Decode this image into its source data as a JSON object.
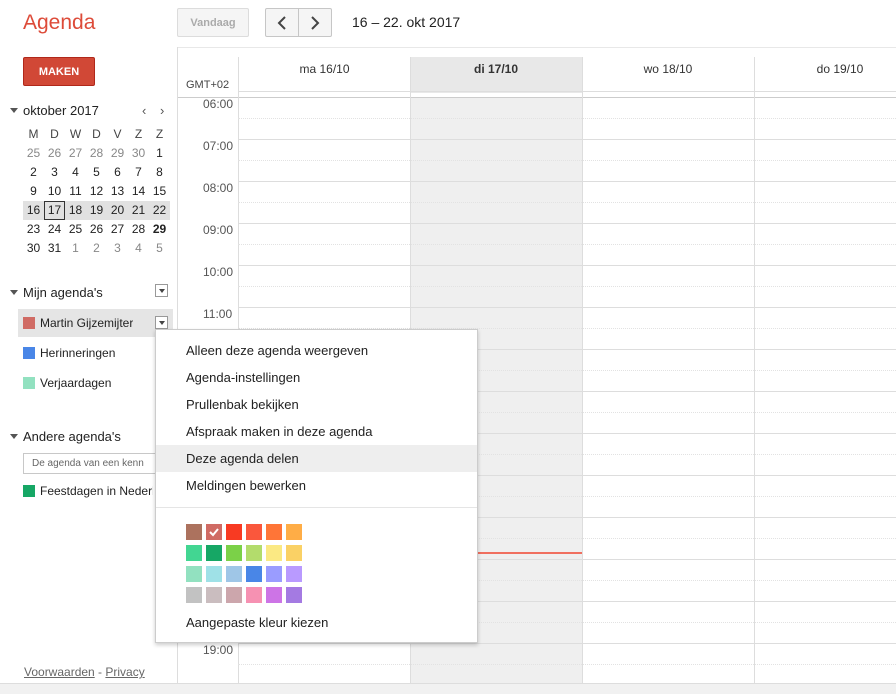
{
  "header": {
    "app_title": "Agenda",
    "today_label": "Vandaag",
    "date_range": "16 – 22. okt 2017",
    "create_label": "MAKEN"
  },
  "mini_calendar": {
    "title": "oktober 2017",
    "prev": "‹",
    "next": "›",
    "dow": [
      "M",
      "D",
      "W",
      "D",
      "V",
      "Z",
      "Z"
    ],
    "weeks": [
      [
        "25",
        "26",
        "27",
        "28",
        "29",
        "30",
        "1"
      ],
      [
        "2",
        "3",
        "4",
        "5",
        "6",
        "7",
        "8"
      ],
      [
        "9",
        "10",
        "11",
        "12",
        "13",
        "14",
        "15"
      ],
      [
        "16",
        "17",
        "18",
        "19",
        "20",
        "21",
        "22"
      ],
      [
        "23",
        "24",
        "25",
        "26",
        "27",
        "28",
        "29"
      ],
      [
        "30",
        "31",
        "1",
        "2",
        "3",
        "4",
        "5"
      ]
    ]
  },
  "my_calendars": {
    "title": "Mijn agenda's",
    "items": [
      {
        "name": "Martin Gijzemijter",
        "color": "#d06b64"
      },
      {
        "name": "Herinneringen",
        "color": "#4986e7"
      },
      {
        "name": "Verjaardagen",
        "color": "#92e1c0"
      }
    ]
  },
  "other_calendars": {
    "title": "Andere agenda's",
    "search_placeholder": "De agenda van een kenn",
    "items": [
      {
        "name": "Feestdagen in Nederland",
        "color": "#16a765"
      }
    ]
  },
  "footer": {
    "terms": "Voorwaarden",
    "sep": " - ",
    "privacy": "Privacy"
  },
  "grid": {
    "timezone": "GMT+02",
    "days": [
      "ma 16/10",
      "di 17/10",
      "wo 18/10",
      "do 19/10"
    ],
    "hours": [
      "06:00",
      "07:00",
      "08:00",
      "09:00",
      "10:00",
      "11:00",
      "19:00"
    ]
  },
  "context_menu": {
    "items": [
      "Alleen deze agenda weergeven",
      "Agenda-instellingen",
      "Prullenbak bekijken",
      "Afspraak maken in deze agenda",
      "Deze agenda delen",
      "Meldingen bewerken"
    ],
    "custom_color": "Aangepaste kleur kiezen",
    "palette": [
      [
        "#ac725e",
        "#d06b64",
        "#f83a22",
        "#fa573c",
        "#ff7537",
        "#ffad46"
      ],
      [
        "#42d692",
        "#16a765",
        "#7bd148",
        "#b3dc6c",
        "#fbe983",
        "#fad165"
      ],
      [
        "#92e1c0",
        "#9fe1e7",
        "#9fc6e7",
        "#4986e7",
        "#9a9cff",
        "#b99aff"
      ],
      [
        "#c2c2c2",
        "#cabdbf",
        "#cca6ac",
        "#f691b2",
        "#cd74e6",
        "#a47ae2"
      ]
    ]
  }
}
